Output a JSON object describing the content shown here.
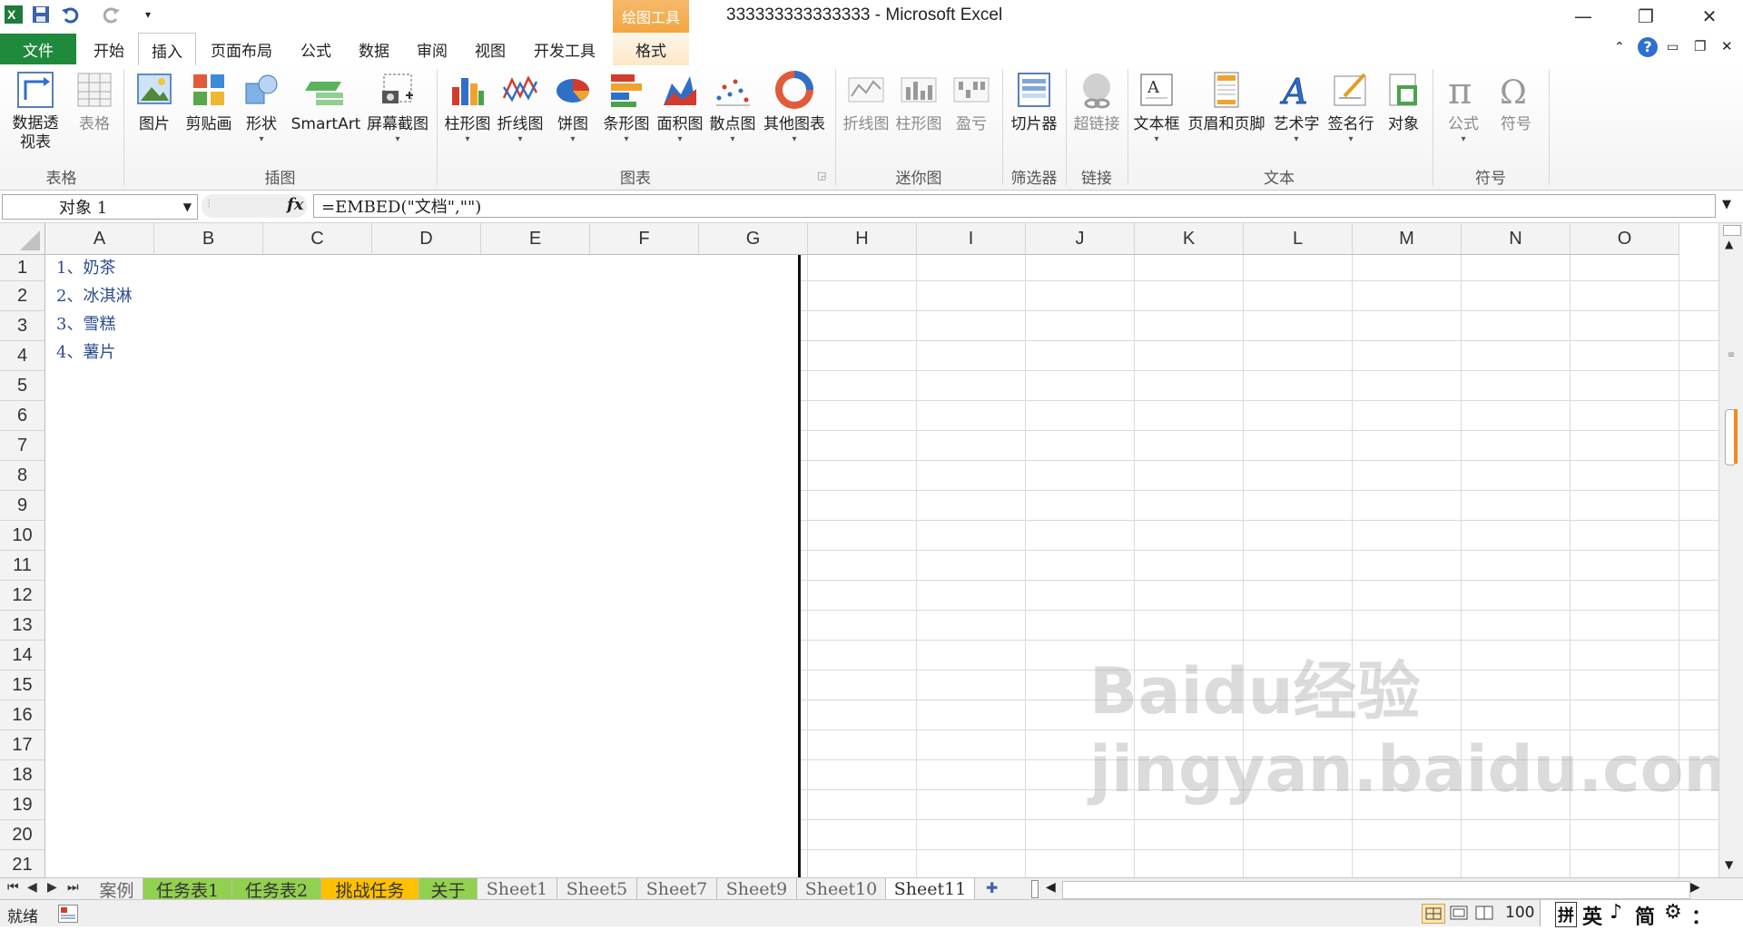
{
  "window": {
    "title": "333333333333333  -  Microsoft Excel",
    "context_tab_header": "绘图工具",
    "minimize_glyph": "—",
    "restore_glyph": "❐",
    "close_glyph": "✕",
    "help_glyph": "?"
  },
  "tabs": {
    "file": "文件",
    "home": "开始",
    "insert": "插入",
    "layout": "页面布局",
    "formulas": "公式",
    "data": "数据",
    "review": "审阅",
    "view": "视图",
    "developer": "开发工具",
    "format": "格式"
  },
  "ribbon": {
    "pivot": "数据透视表",
    "table": "表格",
    "picture": "图片",
    "clipart": "剪贴画",
    "shapes": "形状",
    "smartart": "SmartArt",
    "screenshot": "屏幕截图",
    "column_chart": "柱形图",
    "line_chart": "折线图",
    "pie_chart": "饼图",
    "bar_chart": "条形图",
    "area_chart": "面积图",
    "scatter_chart": "散点图",
    "other_charts": "其他图表",
    "spark_line": "折线图",
    "spark_column": "柱形图",
    "spark_winloss": "盈亏",
    "slicer": "切片器",
    "hyperlink": "超链接",
    "textbox": "文本框",
    "header_footer": "页眉和页脚",
    "wordart": "艺术字",
    "signature": "签名行",
    "object": "对象",
    "equation": "公式",
    "symbol": "符号",
    "groups": {
      "tables": "表格",
      "illustrations": "插图",
      "charts": "图表",
      "sparklines": "迷你图",
      "filter": "筛选器",
      "links": "链接",
      "text": "文本",
      "symbols": "符号"
    }
  },
  "formula_bar": {
    "name_box": "对象 1",
    "fx": "fx",
    "formula": "=EMBED(\"文档\",\"\")"
  },
  "columns": [
    "A",
    "B",
    "C",
    "D",
    "E",
    "F",
    "G",
    "H",
    "I",
    "J",
    "K",
    "L",
    "M",
    "N",
    "O"
  ],
  "rows": [
    "1",
    "2",
    "3",
    "4",
    "5",
    "6",
    "7",
    "8",
    "9",
    "10",
    "11",
    "12",
    "13",
    "14",
    "15",
    "16",
    "17",
    "18",
    "19",
    "20",
    "21"
  ],
  "embedded_document": {
    "lines": [
      "1、奶茶",
      "2、冰淇淋",
      "3、雪糕",
      "4、薯片"
    ]
  },
  "sheet_tabs": [
    {
      "name": "案例",
      "color": ""
    },
    {
      "name": "任务表1",
      "color": "#92d050"
    },
    {
      "name": "任务表2",
      "color": "#92d050"
    },
    {
      "name": "挑战任务",
      "color": "#ffc000"
    },
    {
      "name": "关于",
      "color": "#92d050"
    },
    {
      "name": "Sheet1",
      "color": ""
    },
    {
      "name": "Sheet5",
      "color": ""
    },
    {
      "name": "Sheet7",
      "color": ""
    },
    {
      "name": "Sheet9",
      "color": ""
    },
    {
      "name": "Sheet10",
      "color": ""
    },
    {
      "name": "Sheet11",
      "color": ""
    }
  ],
  "status": {
    "ready": "就绪",
    "zoom": "100",
    "ime": [
      "拼",
      "英",
      "♪",
      "简",
      "⚙",
      "："
    ]
  },
  "watermark": "Baidu经验 jingyan.baidu.com"
}
